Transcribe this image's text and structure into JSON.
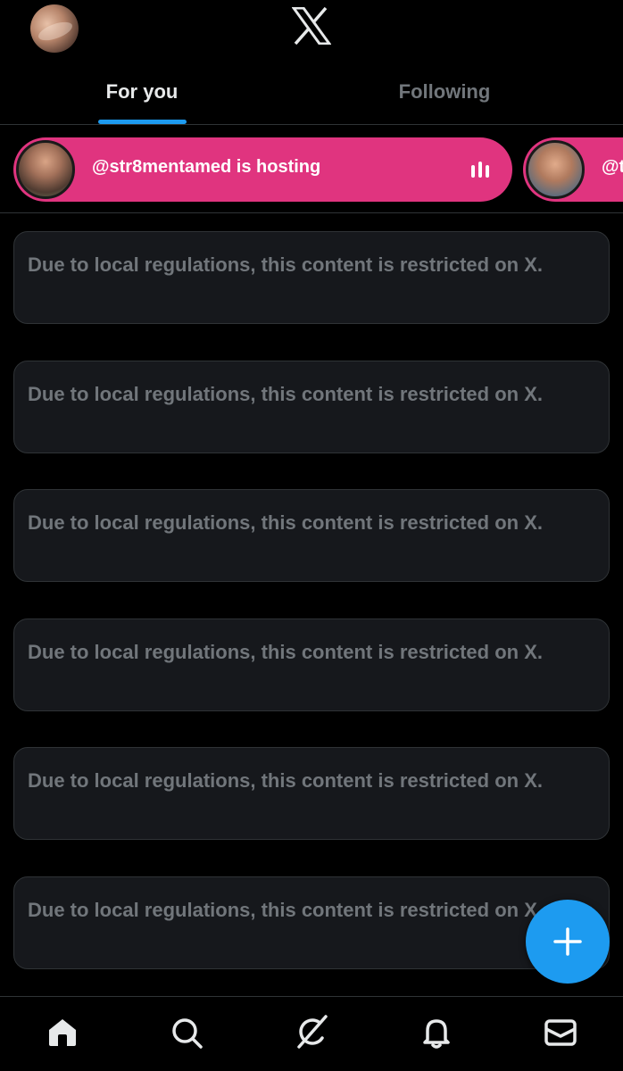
{
  "header": {
    "logo_icon": "x-logo-icon",
    "tabs": [
      {
        "label": "For you",
        "active": true
      },
      {
        "label": "Following",
        "active": false
      }
    ]
  },
  "spaces": [
    {
      "title": "@str8mentamed is hosting",
      "icon": "audio-bars-icon"
    },
    {
      "title": "@t"
    }
  ],
  "feed": [
    {
      "text": "Due to local regulations, this content is restricted on X."
    },
    {
      "text": "Due to local regulations, this content is restricted on X."
    },
    {
      "text": "Due to local regulations, this content is restricted on X."
    },
    {
      "text": "Due to local regulations, this content is restricted on X."
    },
    {
      "text": "Due to local regulations, this content is restricted on X."
    },
    {
      "text": "Due to local regulations, this content is restricted on X."
    }
  ],
  "fab": {
    "icon": "plus-icon"
  },
  "bottom_nav": [
    {
      "icon": "home-icon",
      "active": true
    },
    {
      "icon": "search-icon",
      "active": false
    },
    {
      "icon": "grok-icon",
      "active": false
    },
    {
      "icon": "bell-icon",
      "active": false
    },
    {
      "icon": "mail-icon",
      "active": false
    }
  ],
  "colors": {
    "background": "#000000",
    "accent": "#1d9bf0",
    "space_pill": "#e0347f",
    "card": "#16181c",
    "muted_text": "#71767b"
  }
}
